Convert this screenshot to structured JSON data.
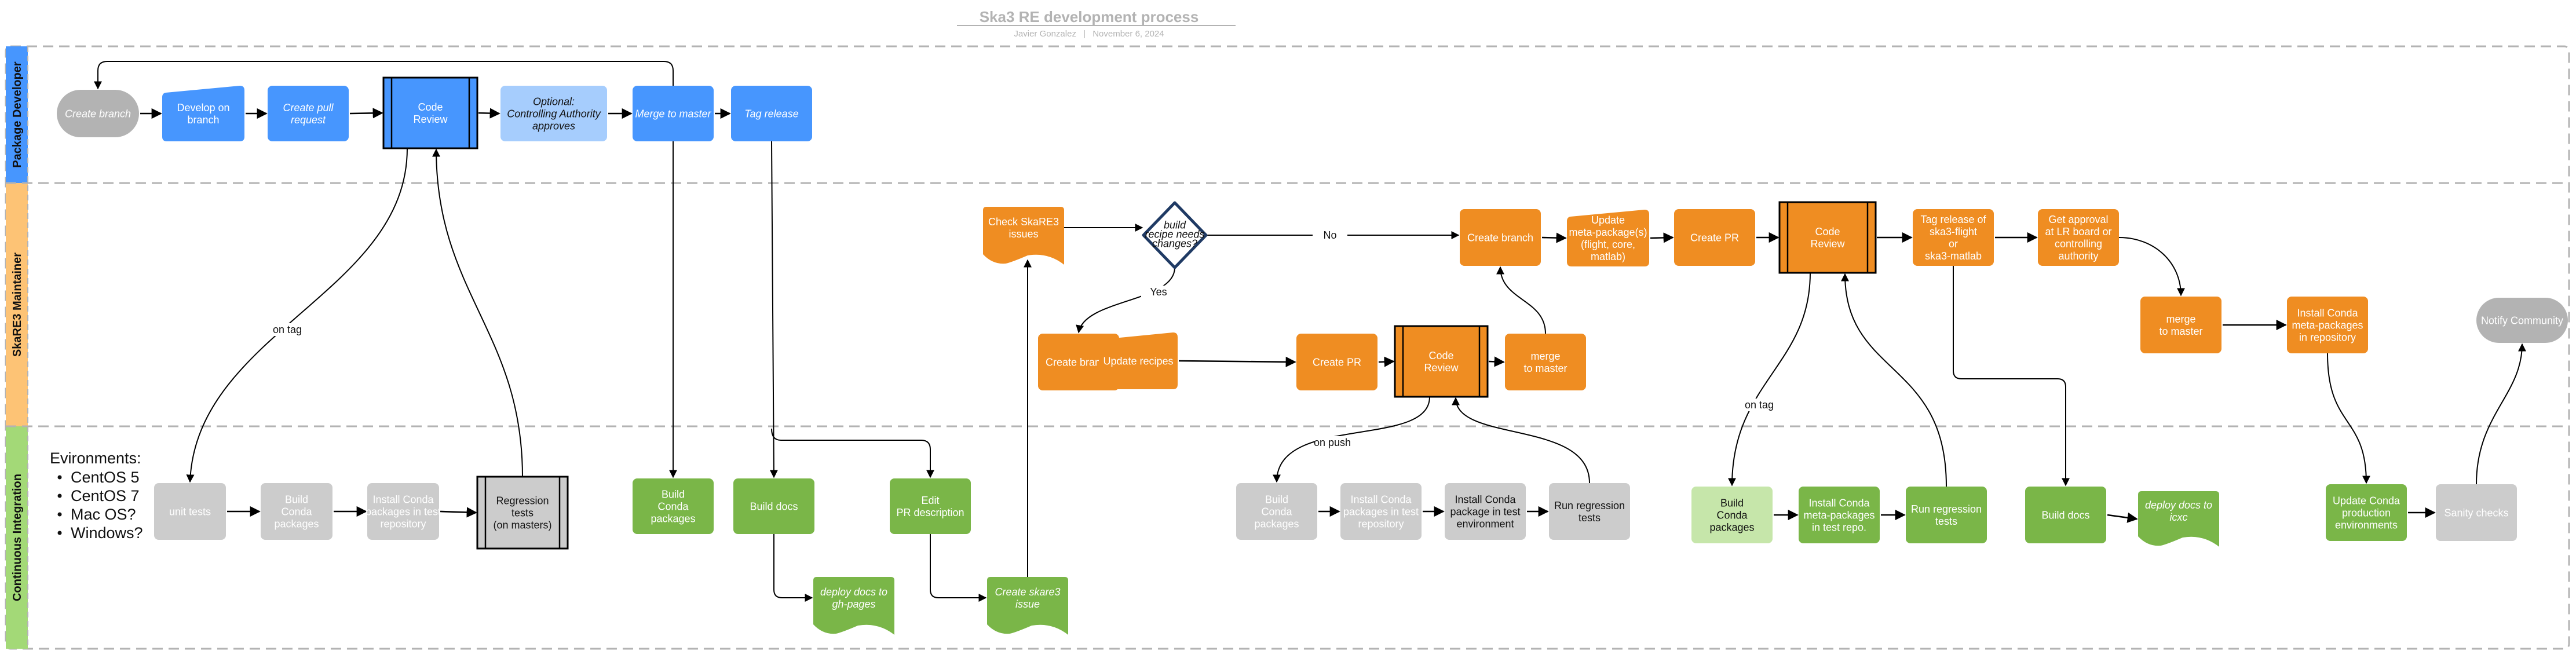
{
  "header": {
    "title": "Ska3 RE development process",
    "author": "Javier Gonzalez",
    "separator": "|",
    "date": "November 6, 2024"
  },
  "colors": {
    "developer_blue": "#4796fe",
    "light_blue": "#a6cdfd",
    "maintainer_orange": "#ef8d22",
    "lane_orange": "#fdc375",
    "ci_green": "#7ab648",
    "lane_green": "#a3d977",
    "light_green": "#c6e6aa",
    "gray": "#cccccc",
    "terminal_gray": "#b3b3b3",
    "decision_border": "#1f3a64",
    "lane_border": "#b3b3b3"
  },
  "lanes": [
    {
      "id": "developer",
      "label": "Package Developer"
    },
    {
      "id": "maintainer",
      "label": "SkaRE3 Maintainer"
    },
    {
      "id": "ci",
      "label": "Continuous Integration"
    }
  ],
  "environments": {
    "heading": "Evironments:",
    "items": [
      "CentOS 5",
      "CentOS 7",
      "Mac OS?",
      "Windows?"
    ]
  },
  "nodes": [
    {
      "id": "dev_create_branch",
      "lines": [
        "Create branch"
      ],
      "style": "terminal",
      "italic": true
    },
    {
      "id": "dev_develop",
      "lines": [
        "Develop on",
        "branch"
      ],
      "style": "manual-blue"
    },
    {
      "id": "dev_create_pr",
      "lines": [
        "Create pull",
        "request"
      ],
      "style": "blue",
      "italic": true
    },
    {
      "id": "dev_code_review",
      "lines": [
        "Code",
        "Review"
      ],
      "style": "subprocess-blue"
    },
    {
      "id": "dev_optional_approval",
      "lines": [
        "Optional:",
        "Controlling Authority",
        "approves"
      ],
      "style": "light-blue",
      "italic": true
    },
    {
      "id": "dev_merge",
      "lines": [
        "Merge to master"
      ],
      "style": "blue",
      "italic": true
    },
    {
      "id": "dev_tag_release",
      "lines": [
        "Tag release"
      ],
      "style": "blue",
      "italic": true
    },
    {
      "id": "ci_unit_tests",
      "lines": [
        "unit tests"
      ],
      "style": "gray"
    },
    {
      "id": "ci_build_conda_1",
      "lines": [
        "Build",
        "Conda",
        "packages"
      ],
      "style": "gray"
    },
    {
      "id": "ci_install_conda_1",
      "lines": [
        "Install Conda",
        "packages in test",
        "repository"
      ],
      "style": "gray"
    },
    {
      "id": "ci_regression_masters",
      "lines": [
        "Regression",
        "tests",
        "(on masters)"
      ],
      "style": "subprocess-gray"
    },
    {
      "id": "ci_build_conda_2",
      "lines": [
        "Build",
        "Conda",
        "packages"
      ],
      "style": "green"
    },
    {
      "id": "ci_build_docs_1",
      "lines": [
        "Build docs"
      ],
      "style": "green"
    },
    {
      "id": "ci_deploy_ghpages",
      "lines": [
        "deploy docs to",
        "gh-pages"
      ],
      "style": "doc-green",
      "italic": true
    },
    {
      "id": "ci_edit_pr",
      "lines": [
        "Edit",
        "PR description"
      ],
      "style": "green"
    },
    {
      "id": "ci_create_issue",
      "lines": [
        "Create skare3",
        "issue"
      ],
      "style": "doc-green",
      "italic": true
    },
    {
      "id": "m_check_issues",
      "lines": [
        "Check SkaRE3",
        "issues"
      ],
      "style": "doc-orange"
    },
    {
      "id": "m_decision",
      "lines": [
        "build",
        "recipe needs",
        "changes?"
      ],
      "style": "decision"
    },
    {
      "id": "m_create_branch_1",
      "lines": [
        "Create branch"
      ],
      "style": "orange"
    },
    {
      "id": "m_update_recipes",
      "lines": [
        "Update recipes"
      ],
      "style": "manual-orange"
    },
    {
      "id": "m_create_pr_1",
      "lines": [
        "Create PR"
      ],
      "style": "orange"
    },
    {
      "id": "m_code_review_1",
      "lines": [
        "Code",
        "Review"
      ],
      "style": "subprocess-orange"
    },
    {
      "id": "m_merge_1",
      "lines": [
        "merge",
        "to master"
      ],
      "style": "orange"
    },
    {
      "id": "ci_build_conda_3",
      "lines": [
        "Build",
        "Conda",
        "packages"
      ],
      "style": "gray"
    },
    {
      "id": "ci_install_conda_3",
      "lines": [
        "Install Conda",
        "packages in test",
        "repository"
      ],
      "style": "gray"
    },
    {
      "id": "ci_install_env",
      "lines": [
        "Install Conda",
        "package in test",
        "environment"
      ],
      "style": "gray-dark"
    },
    {
      "id": "ci_run_regression_1",
      "lines": [
        "Run regression",
        "tests"
      ],
      "style": "gray-dark"
    },
    {
      "id": "m_create_branch_2",
      "lines": [
        "Create branch"
      ],
      "style": "orange"
    },
    {
      "id": "m_update_meta",
      "lines": [
        "Update",
        "meta-package(s)",
        "(flight, core,",
        "matlab)"
      ],
      "style": "manual-orange"
    },
    {
      "id": "m_create_pr_2",
      "lines": [
        "Create PR"
      ],
      "style": "orange"
    },
    {
      "id": "m_code_review_2",
      "lines": [
        "Code",
        "Review"
      ],
      "style": "subprocess-orange"
    },
    {
      "id": "m_tag_release",
      "lines": [
        "Tag release of",
        "ska3-flight",
        "or",
        "ska3-matlab"
      ],
      "style": "orange"
    },
    {
      "id": "m_get_approval",
      "lines": [
        "Get approval",
        "at LR board or",
        "controlling",
        "authority"
      ],
      "style": "orange"
    },
    {
      "id": "m_merge_2",
      "lines": [
        "merge",
        "to master"
      ],
      "style": "orange"
    },
    {
      "id": "m_install_meta",
      "lines": [
        "Install Conda",
        "meta-packages",
        "in repository"
      ],
      "style": "orange"
    },
    {
      "id": "m_notify",
      "lines": [
        "Notify Community"
      ],
      "style": "terminal"
    },
    {
      "id": "ci_build_conda_4",
      "lines": [
        "Build",
        "Conda",
        "packages"
      ],
      "style": "light-green"
    },
    {
      "id": "ci_install_meta_test",
      "lines": [
        "Install Conda",
        "meta-packages",
        "in test repo."
      ],
      "style": "green"
    },
    {
      "id": "ci_run_regression_2",
      "lines": [
        "Run regression",
        "tests"
      ],
      "style": "green"
    },
    {
      "id": "ci_build_docs_2",
      "lines": [
        "Build docs"
      ],
      "style": "green"
    },
    {
      "id": "ci_deploy_icxc",
      "lines": [
        "deploy docs to",
        "icxc"
      ],
      "style": "doc-green",
      "italic": true
    },
    {
      "id": "ci_update_prod",
      "lines": [
        "Update Conda",
        "production",
        "environments"
      ],
      "style": "green"
    },
    {
      "id": "ci_sanity",
      "lines": [
        "Sanity checks"
      ],
      "style": "gray"
    }
  ],
  "edges": [
    {
      "from": "dev_create_branch",
      "to": "dev_develop"
    },
    {
      "from": "dev_develop",
      "to": "dev_create_pr"
    },
    {
      "from": "dev_create_pr",
      "to": "dev_code_review"
    },
    {
      "from": "dev_code_review",
      "to": "dev_optional_approval"
    },
    {
      "from": "dev_optional_approval",
      "to": "dev_merge"
    },
    {
      "from": "dev_merge",
      "to": "dev_tag_release"
    },
    {
      "from": "dev_merge",
      "to": "dev_create_branch",
      "label": ""
    },
    {
      "from": "dev_code_review",
      "to": "ci_unit_tests",
      "label": "on tag"
    },
    {
      "from": "ci_regression_masters",
      "to": "dev_code_review"
    },
    {
      "from": "dev_merge",
      "to": "ci_build_conda_2"
    },
    {
      "from": "dev_tag_release",
      "to": "ci_build_docs_1"
    },
    {
      "from": "dev_tag_release",
      "to": "ci_edit_pr"
    },
    {
      "from": "ci_unit_tests",
      "to": "ci_build_conda_1"
    },
    {
      "from": "ci_build_conda_1",
      "to": "ci_install_conda_1"
    },
    {
      "from": "ci_install_conda_1",
      "to": "ci_regression_masters"
    },
    {
      "from": "ci_build_docs_1",
      "to": "ci_deploy_ghpages"
    },
    {
      "from": "ci_edit_pr",
      "to": "ci_create_issue"
    },
    {
      "from": "ci_create_issue",
      "to": "m_check_issues"
    },
    {
      "from": "m_check_issues",
      "to": "m_decision"
    },
    {
      "from": "m_decision",
      "to": "m_create_branch_2",
      "label": "No"
    },
    {
      "from": "m_decision",
      "to": "m_create_branch_1",
      "label": "Yes"
    },
    {
      "from": "m_create_branch_1",
      "to": "m_update_recipes"
    },
    {
      "from": "m_update_recipes",
      "to": "m_create_pr_1"
    },
    {
      "from": "m_create_pr_1",
      "to": "m_code_review_1"
    },
    {
      "from": "m_code_review_1",
      "to": "m_merge_1"
    },
    {
      "from": "m_code_review_1",
      "to": "ci_build_conda_3",
      "label": "on push"
    },
    {
      "from": "ci_run_regression_1",
      "to": "m_code_review_1"
    },
    {
      "from": "ci_build_conda_3",
      "to": "ci_install_conda_3"
    },
    {
      "from": "ci_install_conda_3",
      "to": "ci_install_env"
    },
    {
      "from": "ci_install_env",
      "to": "ci_run_regression_1"
    },
    {
      "from": "m_merge_1",
      "to": "m_create_branch_2"
    },
    {
      "from": "m_create_branch_2",
      "to": "m_update_meta"
    },
    {
      "from": "m_update_meta",
      "to": "m_create_pr_2"
    },
    {
      "from": "m_create_pr_2",
      "to": "m_code_review_2"
    },
    {
      "from": "m_code_review_2",
      "to": "m_tag_release"
    },
    {
      "from": "m_tag_release",
      "to": "m_get_approval"
    },
    {
      "from": "m_code_review_2",
      "to": "ci_build_conda_4",
      "label": "on tag"
    },
    {
      "from": "ci_run_regression_2",
      "to": "m_code_review_2"
    },
    {
      "from": "ci_build_conda_4",
      "to": "ci_install_meta_test"
    },
    {
      "from": "ci_install_meta_test",
      "to": "ci_run_regression_2"
    },
    {
      "from": "m_tag_release",
      "to": "ci_build_docs_2"
    },
    {
      "from": "ci_build_docs_2",
      "to": "ci_deploy_icxc"
    },
    {
      "from": "m_get_approval",
      "to": "m_merge_2"
    },
    {
      "from": "m_merge_2",
      "to": "m_install_meta"
    },
    {
      "from": "m_install_meta",
      "to": "ci_update_prod"
    },
    {
      "from": "ci_update_prod",
      "to": "ci_sanity"
    },
    {
      "from": "ci_sanity",
      "to": "m_notify"
    }
  ]
}
